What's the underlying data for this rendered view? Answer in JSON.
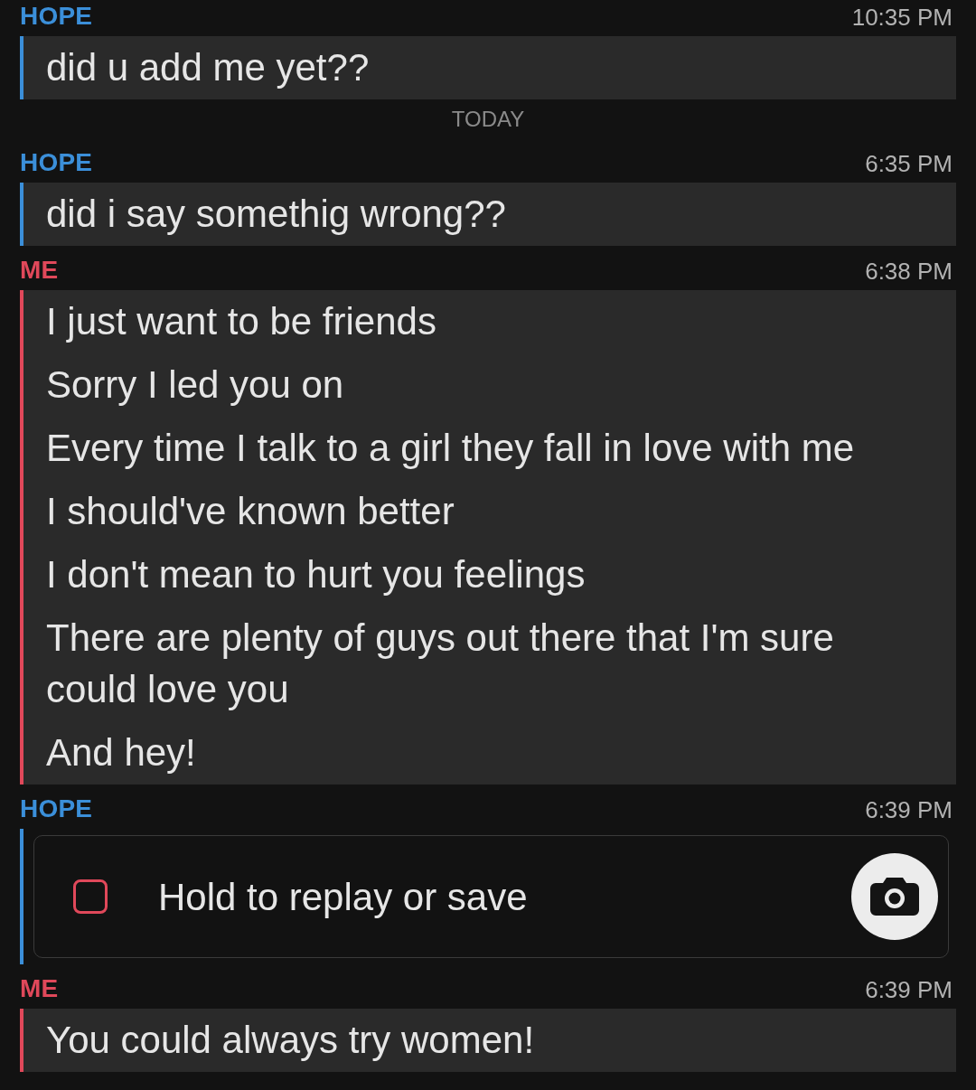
{
  "conversation": [
    {
      "kind": "text",
      "sender": "HOPE",
      "color": "#3b8fd9",
      "time": "10:35 PM",
      "lines": [
        "did u add me yet??"
      ]
    },
    {
      "kind": "divider",
      "label": "TODAY"
    },
    {
      "kind": "text",
      "sender": "HOPE",
      "color": "#3b8fd9",
      "time": "6:35 PM",
      "lines": [
        "did i say somethig wrong??"
      ]
    },
    {
      "kind": "text",
      "sender": "ME",
      "color": "#e0485a",
      "time": "6:38 PM",
      "lines": [
        "I just want to be friends",
        "Sorry I led you on",
        "Every time I talk to a girl they fall in love with me",
        "I should've known better",
        "I don't mean to hurt you feelings",
        "There are plenty of guys out there that I'm sure could love you",
        "And hey!"
      ]
    },
    {
      "kind": "snap",
      "sender": "HOPE",
      "color": "#3b8fd9",
      "time": "6:39 PM",
      "label": "Hold to replay or save"
    },
    {
      "kind": "text",
      "sender": "ME",
      "color": "#e0485a",
      "time": "6:39 PM",
      "lines": [
        "You could always try women!"
      ]
    }
  ]
}
